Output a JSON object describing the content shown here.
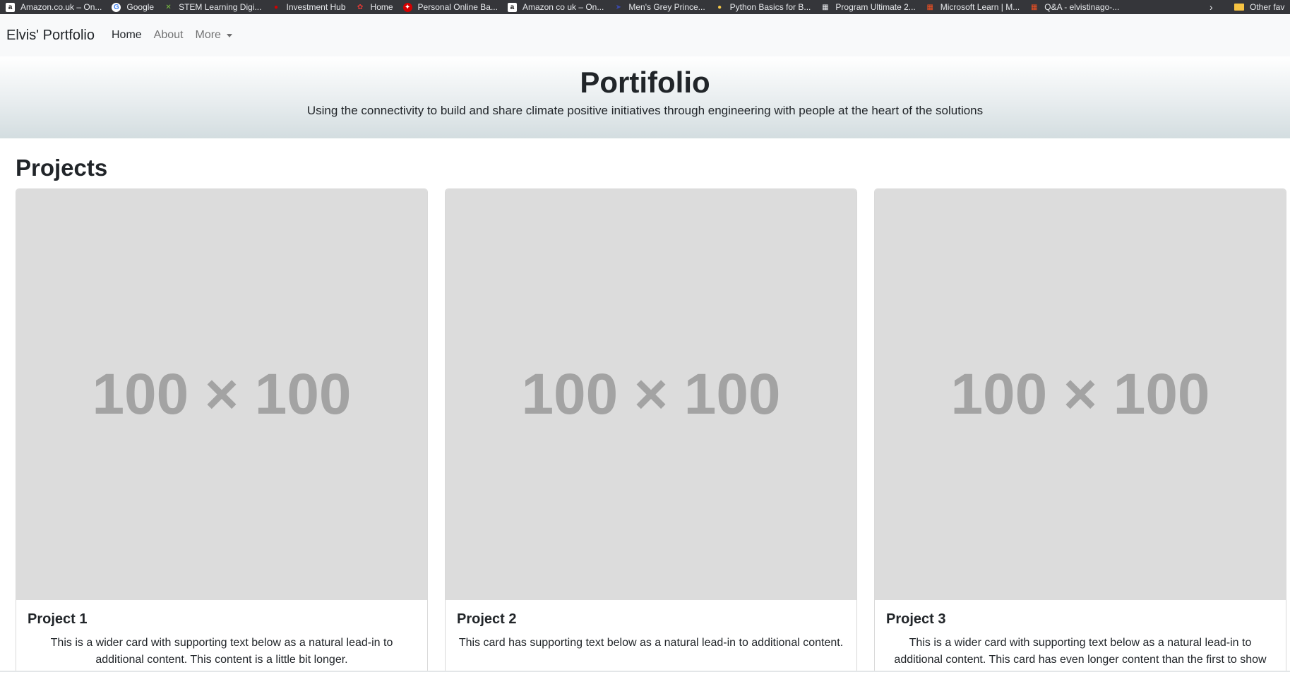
{
  "bookmarks": [
    {
      "label": "Amazon.co.uk – On...",
      "icon": "amazon-icon",
      "color": "#ffffff",
      "glyph": "a"
    },
    {
      "label": "Google",
      "icon": "google-icon",
      "color": "#4285f4",
      "glyph": "G"
    },
    {
      "label": "STEM Learning Digi...",
      "icon": "stem-icon",
      "color": "#7cc243",
      "glyph": "✕"
    },
    {
      "label": "Investment Hub",
      "icon": "investment-hub-icon",
      "color": "#d50000",
      "glyph": "●"
    },
    {
      "label": "Home",
      "icon": "home-site-icon",
      "color": "#e53935",
      "glyph": "✿"
    },
    {
      "label": "Personal Online Ba...",
      "icon": "bank-icon",
      "color": "#d50000",
      "glyph": "✦"
    },
    {
      "label": "Amazon co uk – On...",
      "icon": "amazon-icon",
      "color": "#ffffff",
      "glyph": "a"
    },
    {
      "label": "Men's Grey Prince...",
      "icon": "shop-icon",
      "color": "#1a237e",
      "glyph": "➤"
    },
    {
      "label": "Python Basics for B...",
      "icon": "python-icon",
      "color": "#f7c948",
      "glyph": "●"
    },
    {
      "label": "Program Ultimate 2...",
      "icon": "program-icon",
      "color": "#e8eaed",
      "glyph": "▦"
    },
    {
      "label": "Microsoft Learn | M...",
      "icon": "microsoft-icon",
      "color": "#f25022",
      "glyph": "▦"
    },
    {
      "label": "Q&A - elvistinago-...",
      "icon": "microsoft-icon",
      "color": "#f25022",
      "glyph": "▦"
    }
  ],
  "bookmarks_more": "›",
  "other_favorites": "Other fav",
  "navbar": {
    "brand": "Elvis' Portfolio",
    "links": [
      "Home",
      "About",
      "More"
    ]
  },
  "hero": {
    "title": "Portifolio",
    "subtitle": "Using the connectivity to build and share climate positive initiatives through engineering with people at the heart of the solutions"
  },
  "projects": {
    "heading": "Projects",
    "cards": [
      {
        "image_text": "100 × 100",
        "title": "Project 1",
        "text": "This is a wider card with supporting text below as a natural lead-in to additional content. This content is a little bit longer."
      },
      {
        "image_text": "100 × 100",
        "title": "Project 2",
        "text": "This card has supporting text below as a natural lead-in to additional content."
      },
      {
        "image_text": "100 × 100",
        "title": "Project 3",
        "text": "This is a wider card with supporting text below as a natural lead-in to additional content. This card has even longer content than the first to show that equal height action."
      }
    ]
  }
}
